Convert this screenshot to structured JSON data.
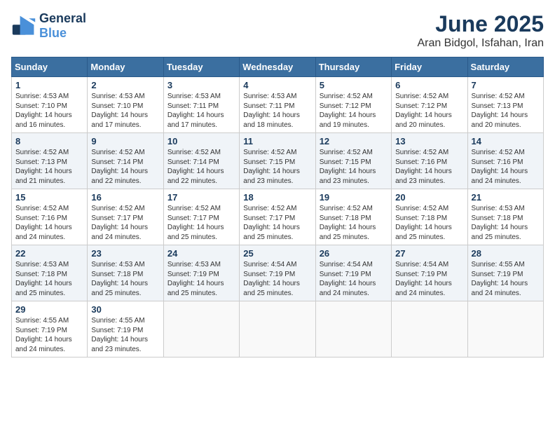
{
  "logo": {
    "text_general": "General",
    "text_blue": "Blue"
  },
  "title": {
    "month": "June 2025",
    "location": "Aran Bidgol, Isfahan, Iran"
  },
  "weekdays": [
    "Sunday",
    "Monday",
    "Tuesday",
    "Wednesday",
    "Thursday",
    "Friday",
    "Saturday"
  ],
  "weeks": [
    [
      {
        "day": "1",
        "sunrise": "4:53 AM",
        "sunset": "7:10 PM",
        "daylight": "14 hours and 16 minutes."
      },
      {
        "day": "2",
        "sunrise": "4:53 AM",
        "sunset": "7:10 PM",
        "daylight": "14 hours and 17 minutes."
      },
      {
        "day": "3",
        "sunrise": "4:53 AM",
        "sunset": "7:11 PM",
        "daylight": "14 hours and 17 minutes."
      },
      {
        "day": "4",
        "sunrise": "4:53 AM",
        "sunset": "7:11 PM",
        "daylight": "14 hours and 18 minutes."
      },
      {
        "day": "5",
        "sunrise": "4:52 AM",
        "sunset": "7:12 PM",
        "daylight": "14 hours and 19 minutes."
      },
      {
        "day": "6",
        "sunrise": "4:52 AM",
        "sunset": "7:12 PM",
        "daylight": "14 hours and 20 minutes."
      },
      {
        "day": "7",
        "sunrise": "4:52 AM",
        "sunset": "7:13 PM",
        "daylight": "14 hours and 20 minutes."
      }
    ],
    [
      {
        "day": "8",
        "sunrise": "4:52 AM",
        "sunset": "7:13 PM",
        "daylight": "14 hours and 21 minutes."
      },
      {
        "day": "9",
        "sunrise": "4:52 AM",
        "sunset": "7:14 PM",
        "daylight": "14 hours and 22 minutes."
      },
      {
        "day": "10",
        "sunrise": "4:52 AM",
        "sunset": "7:14 PM",
        "daylight": "14 hours and 22 minutes."
      },
      {
        "day": "11",
        "sunrise": "4:52 AM",
        "sunset": "7:15 PM",
        "daylight": "14 hours and 23 minutes."
      },
      {
        "day": "12",
        "sunrise": "4:52 AM",
        "sunset": "7:15 PM",
        "daylight": "14 hours and 23 minutes."
      },
      {
        "day": "13",
        "sunrise": "4:52 AM",
        "sunset": "7:16 PM",
        "daylight": "14 hours and 23 minutes."
      },
      {
        "day": "14",
        "sunrise": "4:52 AM",
        "sunset": "7:16 PM",
        "daylight": "14 hours and 24 minutes."
      }
    ],
    [
      {
        "day": "15",
        "sunrise": "4:52 AM",
        "sunset": "7:16 PM",
        "daylight": "14 hours and 24 minutes."
      },
      {
        "day": "16",
        "sunrise": "4:52 AM",
        "sunset": "7:17 PM",
        "daylight": "14 hours and 24 minutes."
      },
      {
        "day": "17",
        "sunrise": "4:52 AM",
        "sunset": "7:17 PM",
        "daylight": "14 hours and 25 minutes."
      },
      {
        "day": "18",
        "sunrise": "4:52 AM",
        "sunset": "7:17 PM",
        "daylight": "14 hours and 25 minutes."
      },
      {
        "day": "19",
        "sunrise": "4:52 AM",
        "sunset": "7:18 PM",
        "daylight": "14 hours and 25 minutes."
      },
      {
        "day": "20",
        "sunrise": "4:52 AM",
        "sunset": "7:18 PM",
        "daylight": "14 hours and 25 minutes."
      },
      {
        "day": "21",
        "sunrise": "4:53 AM",
        "sunset": "7:18 PM",
        "daylight": "14 hours and 25 minutes."
      }
    ],
    [
      {
        "day": "22",
        "sunrise": "4:53 AM",
        "sunset": "7:18 PM",
        "daylight": "14 hours and 25 minutes."
      },
      {
        "day": "23",
        "sunrise": "4:53 AM",
        "sunset": "7:18 PM",
        "daylight": "14 hours and 25 minutes."
      },
      {
        "day": "24",
        "sunrise": "4:53 AM",
        "sunset": "7:19 PM",
        "daylight": "14 hours and 25 minutes."
      },
      {
        "day": "25",
        "sunrise": "4:54 AM",
        "sunset": "7:19 PM",
        "daylight": "14 hours and 25 minutes."
      },
      {
        "day": "26",
        "sunrise": "4:54 AM",
        "sunset": "7:19 PM",
        "daylight": "14 hours and 24 minutes."
      },
      {
        "day": "27",
        "sunrise": "4:54 AM",
        "sunset": "7:19 PM",
        "daylight": "14 hours and 24 minutes."
      },
      {
        "day": "28",
        "sunrise": "4:55 AM",
        "sunset": "7:19 PM",
        "daylight": "14 hours and 24 minutes."
      }
    ],
    [
      {
        "day": "29",
        "sunrise": "4:55 AM",
        "sunset": "7:19 PM",
        "daylight": "14 hours and 24 minutes."
      },
      {
        "day": "30",
        "sunrise": "4:55 AM",
        "sunset": "7:19 PM",
        "daylight": "14 hours and 23 minutes."
      },
      null,
      null,
      null,
      null,
      null
    ]
  ],
  "labels": {
    "sunrise": "Sunrise:",
    "sunset": "Sunset:",
    "daylight": "Daylight:"
  }
}
